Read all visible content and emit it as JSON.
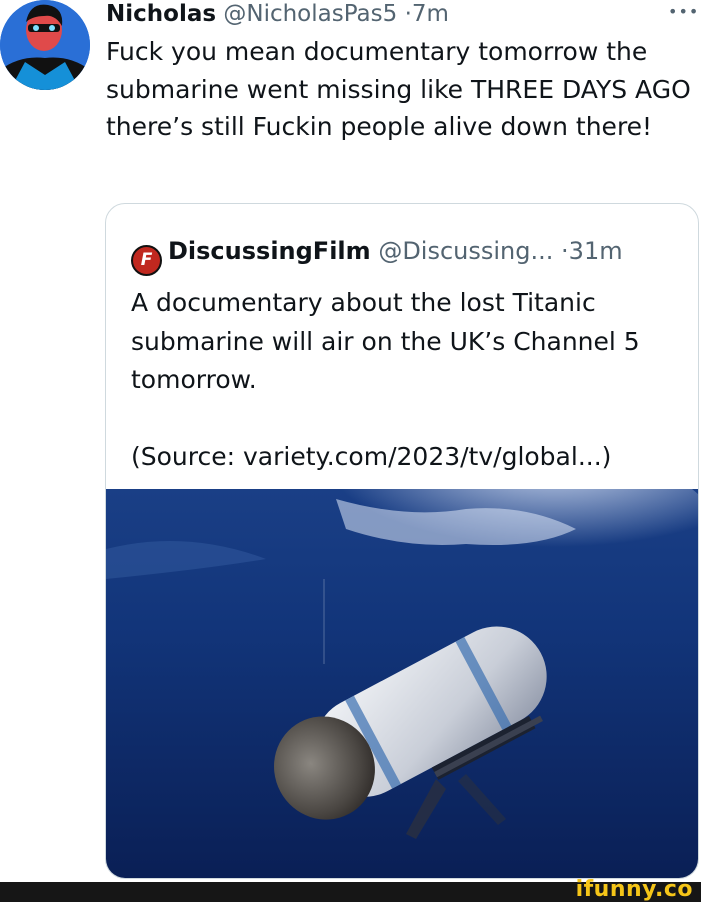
{
  "tweet": {
    "author_name": "Nicholas",
    "author_handle": "@NicholasPas5",
    "separator": "·",
    "time": "7m",
    "more_label": "•••",
    "text": "Fuck you mean documentary tomorrow the submarine went missing like THREE DAYS AGO there’s still Fuckin people alive down there!"
  },
  "quote": {
    "logo_text": "F",
    "author_name": "DiscussingFilm",
    "author_handle": "@Discussing...",
    "separator": "·",
    "time": "31m",
    "text": "A documentary about the lost Titanic submarine will air on the UK’s Channel 5 tomorrow.",
    "source": "(Source: variety.com/2023/tv/global...)",
    "image_alt": "submarine underwater photo"
  },
  "watermark": "ifunny.co",
  "colors": {
    "text": "#0f1419",
    "secondary": "#536471",
    "border": "#cfd9de",
    "brand_red": "#c0281f",
    "ifunny_yellow": "#f5c518"
  }
}
